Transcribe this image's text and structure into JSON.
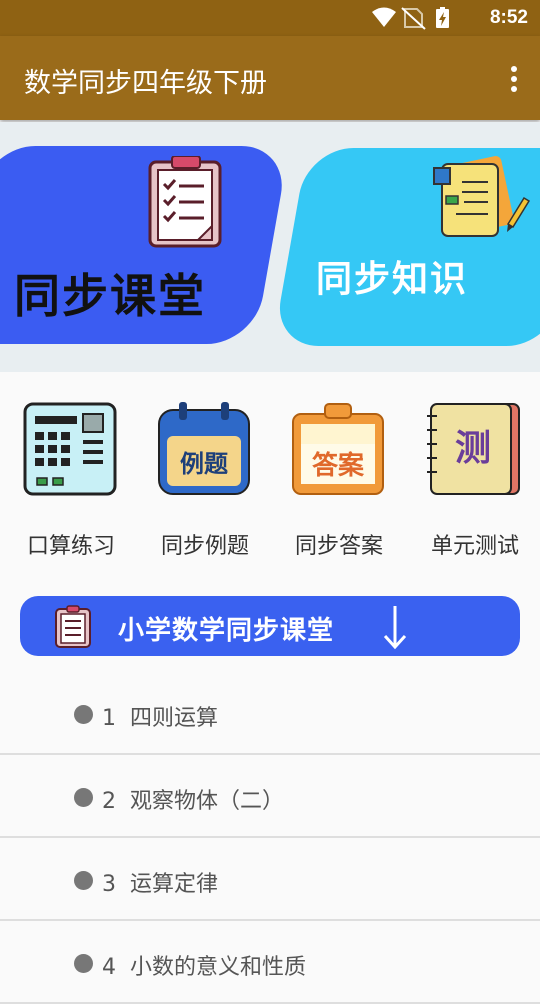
{
  "status": {
    "time": "8:52",
    "icons": [
      "wifi-icon",
      "no-sim-icon",
      "battery-charging-icon"
    ]
  },
  "appbar": {
    "title": "数学同步四年级下册",
    "menu_icon": "more-vert-icon"
  },
  "banner": {
    "left_label": "同步课堂",
    "right_label": "同步知识",
    "left_color": "#3b5cf2",
    "right_color": "#35c8f5"
  },
  "grid": [
    {
      "label": "口算练习",
      "icon": "calculator-icon"
    },
    {
      "label": "同步例题",
      "icon": "calendar-examples-icon",
      "icon_text": "例题"
    },
    {
      "label": "同步答案",
      "icon": "answers-board-icon",
      "icon_text": "答案"
    },
    {
      "label": "单元测试",
      "icon": "test-book-icon",
      "icon_text": "测"
    }
  ],
  "section": {
    "title": "小学数学同步课堂",
    "color": "#3a61f0"
  },
  "lessons": [
    {
      "num": "1",
      "title": "四则运算"
    },
    {
      "num": "2",
      "title": "观察物体（二）"
    },
    {
      "num": "3",
      "title": "运算定律"
    },
    {
      "num": "4",
      "title": "小数的意义和性质"
    }
  ]
}
